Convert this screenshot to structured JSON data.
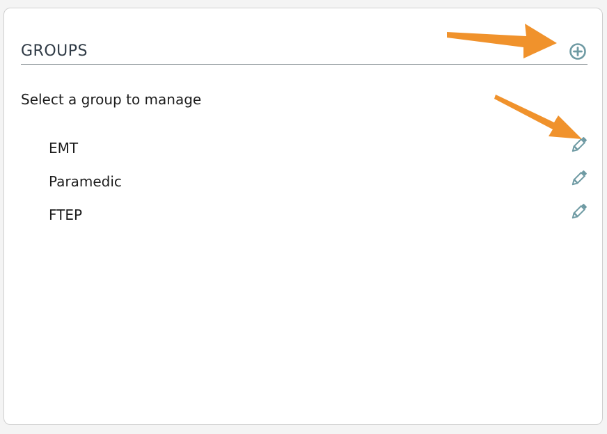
{
  "panel": {
    "title": "GROUPS",
    "add_icon": "plus-circle-icon",
    "instructions": "Select a group to manage"
  },
  "groups": [
    {
      "name": "EMT",
      "edit_icon": "pencil-icon"
    },
    {
      "name": "Paramedic",
      "edit_icon": "pencil-icon"
    },
    {
      "name": "FTEP",
      "edit_icon": "pencil-icon"
    }
  ],
  "annotations": {
    "arrow_color": "#f0922c",
    "arrows": [
      "arrow-to-add-button",
      "arrow-to-edit-button"
    ]
  },
  "colors": {
    "icon": "#6e9aa3",
    "title": "#2f3a45",
    "text": "#1c1c1c",
    "divider": "#8f979c"
  }
}
